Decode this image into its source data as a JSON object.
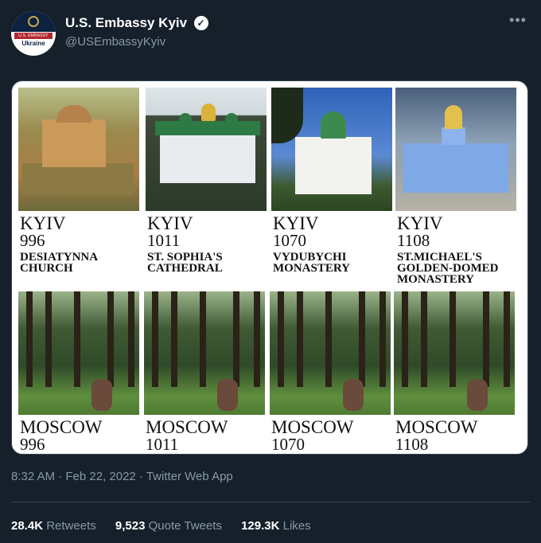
{
  "tweet": {
    "display_name": "U.S. Embassy Kyiv",
    "handle": "@USEmbassyKyiv",
    "verified_icon": "verified-badge-icon",
    "more_icon": "more-icon",
    "avatar": {
      "ribbon_text": "U.S. EMBASSY",
      "country_text": "Ukraine"
    },
    "timestamp": "8:32 AM · Feb 22, 2022 · Twitter Web App",
    "stats": [
      {
        "value": "28.4K",
        "label": "Retweets"
      },
      {
        "value": "9,523",
        "label": "Quote Tweets"
      },
      {
        "value": "129.3K",
        "label": "Likes"
      }
    ]
  },
  "image": {
    "kyiv": [
      {
        "city": "KYIV",
        "year": "996",
        "name": "DESIATYNNA\nCHURCH"
      },
      {
        "city": "KYIV",
        "year": "1011",
        "name": "ST. SOPHIA'S\nCATHEDRAL"
      },
      {
        "city": "KYIV",
        "year": "1070",
        "name": "VYDUBYCHI\nMONASTERY"
      },
      {
        "city": "KYIV",
        "year": "1108",
        "name": "ST.MICHAEL'S\nGOLDEN-DOMED\nMONASTERY"
      }
    ],
    "moscow": [
      {
        "city": "MOSCOW",
        "year": "996"
      },
      {
        "city": "MOSCOW",
        "year": "1011"
      },
      {
        "city": "MOSCOW",
        "year": "1070"
      },
      {
        "city": "MOSCOW",
        "year": "1108"
      }
    ]
  }
}
